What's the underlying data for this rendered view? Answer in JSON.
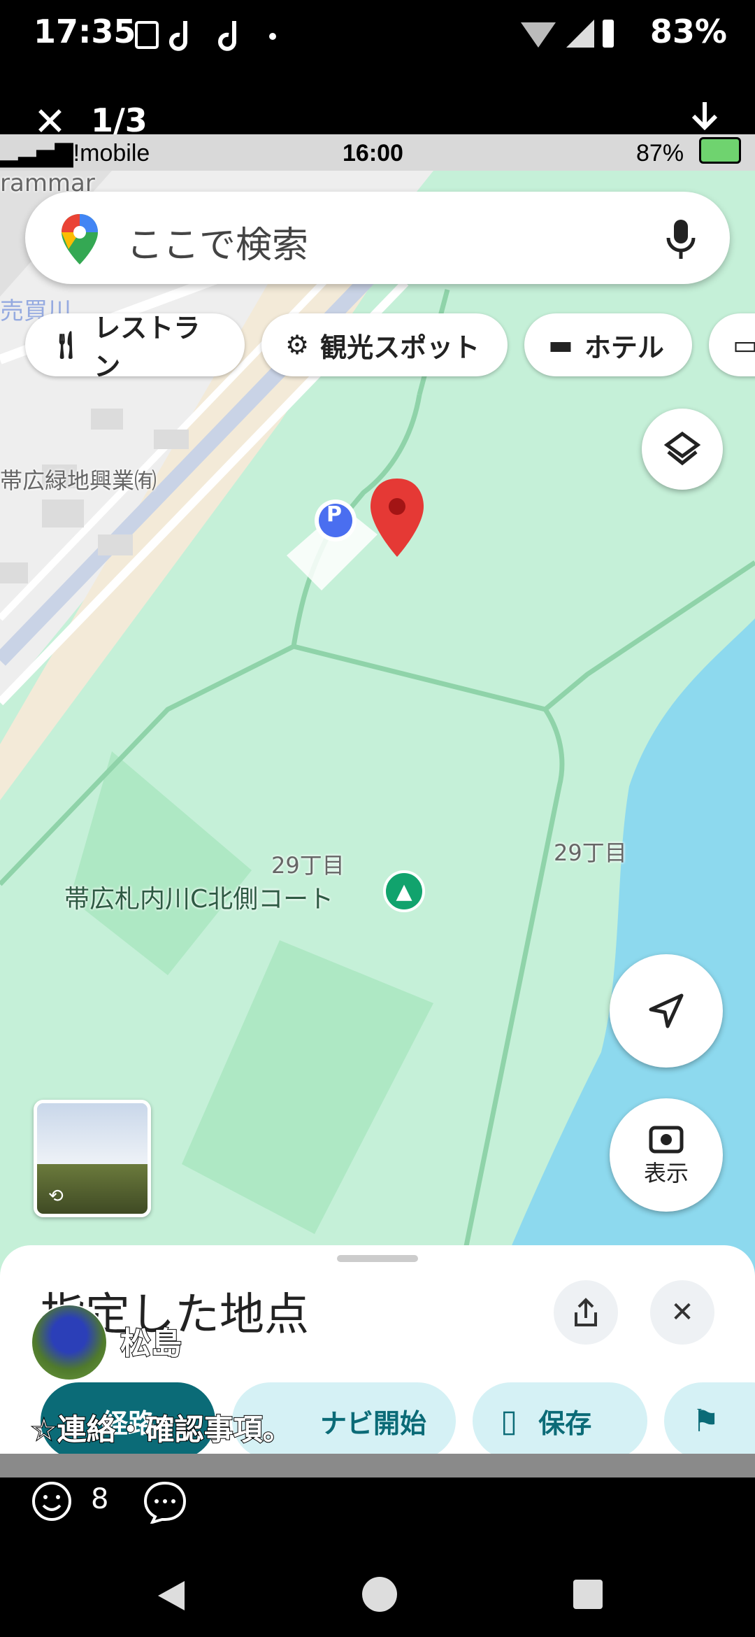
{
  "outer_status": {
    "time": "17:35",
    "battery": "83%"
  },
  "viewer": {
    "counter": "1/3"
  },
  "inner_status": {
    "carrier": "Y!mobile",
    "time": "16:00",
    "battery": "87%"
  },
  "search": {
    "placeholder": "ここで検索"
  },
  "chips": [
    {
      "label": "レストラン",
      "icon": "fork-knife-icon"
    },
    {
      "label": "観光スポット",
      "icon": "ferris-wheel-icon"
    },
    {
      "label": "ホテル",
      "icon": "bed-icon"
    }
  ],
  "map": {
    "edge_label_top": "rammar",
    "company_label": "帯広緑地興業㈲",
    "river_label": "売買川",
    "block_label_1": "29丁目",
    "block_label_2": "29丁目",
    "park_label": "帯広札内川C北側コート",
    "parking_letter": "P"
  },
  "lens": {
    "label": "表示"
  },
  "sheet": {
    "title": "指定した地点",
    "buttons": [
      {
        "label": "経路"
      },
      {
        "label": "ナビ開始"
      },
      {
        "label": "保存"
      }
    ]
  },
  "post": {
    "name": "松島",
    "caption": "☆連絡・確認事項。",
    "reaction_count": "8"
  },
  "colors": {
    "park": "#c5f0d8",
    "water": "#8dd9ee",
    "road": "#ffffff",
    "pin": "#e53935",
    "accent_teal": "#0b6b77"
  }
}
